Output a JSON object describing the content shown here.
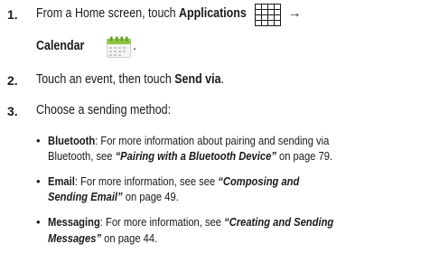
{
  "steps": [
    {
      "num": "1.",
      "line1_pre": "From a Home screen, touch ",
      "line1_bold": "Applications",
      "arrow": "→",
      "line2_bold": "Calendar",
      "line2_post": "."
    },
    {
      "num": "2.",
      "pre": "Touch an event, then touch ",
      "bold": "Send via",
      "post": "."
    },
    {
      "num": "3.",
      "text": "Choose a sending method:"
    }
  ],
  "bullets": [
    {
      "symbol": "•",
      "title": "Bluetooth",
      "line1": ": For more information about pairing and sending via",
      "line2_pre": "Bluetooth, see ",
      "ref": "“Pairing with a Bluetooth Device”",
      "page": " on page 79."
    },
    {
      "symbol": "•",
      "title": "Email",
      "line1_pre": ": For more information, see see ",
      "ref_part1": "“Composing and",
      "ref_part2": "Sending Email”",
      "page": " on page 49."
    },
    {
      "symbol": "•",
      "title": "Messaging",
      "line1_pre": ": For more information, see ",
      "ref_part1": "“Creating and Sending",
      "ref_part2": "Messages”",
      "page": " on page 44."
    }
  ],
  "icons": {
    "applications": "grid-icon",
    "calendar": "calendar-icon"
  }
}
